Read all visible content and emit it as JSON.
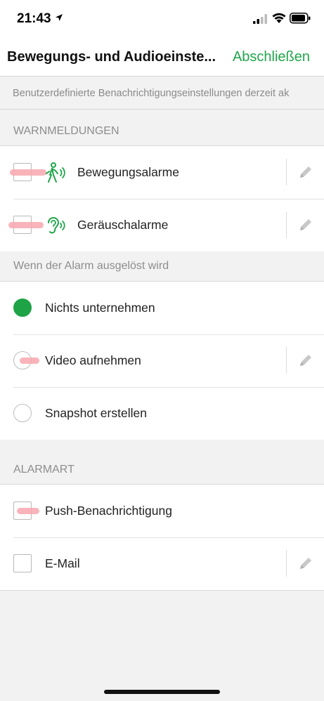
{
  "status": {
    "time": "21:43"
  },
  "nav": {
    "title": "Bewegungs- und Audioeinste...",
    "done": "Abschließen"
  },
  "info": {
    "text": "Benutzerdefinierte Benachrichtigungseinstellungen derzeit ak"
  },
  "sections": {
    "alerts": {
      "header": "WARNMELDUNGEN",
      "items": [
        {
          "label": "Bewegungsalarme",
          "icon": "motion-person-icon",
          "checked": false
        },
        {
          "label": "Geräuschalarme",
          "icon": "ear-sound-icon",
          "checked": false
        }
      ]
    },
    "trigger": {
      "header": "Wenn der Alarm ausgelöst wird",
      "items": [
        {
          "label": "Nichts unternehmen",
          "selected": true
        },
        {
          "label": "Video aufnehmen",
          "selected": false
        },
        {
          "label": "Snapshot erstellen",
          "selected": false
        }
      ]
    },
    "alarm_type": {
      "header": "ALARMART",
      "items": [
        {
          "label": "Push-Benachrichtigung",
          "checked": false
        },
        {
          "label": "E-Mail",
          "checked": false
        }
      ]
    }
  },
  "colors": {
    "accent": "#1fa54a",
    "redaction": "#f7a7ae"
  }
}
